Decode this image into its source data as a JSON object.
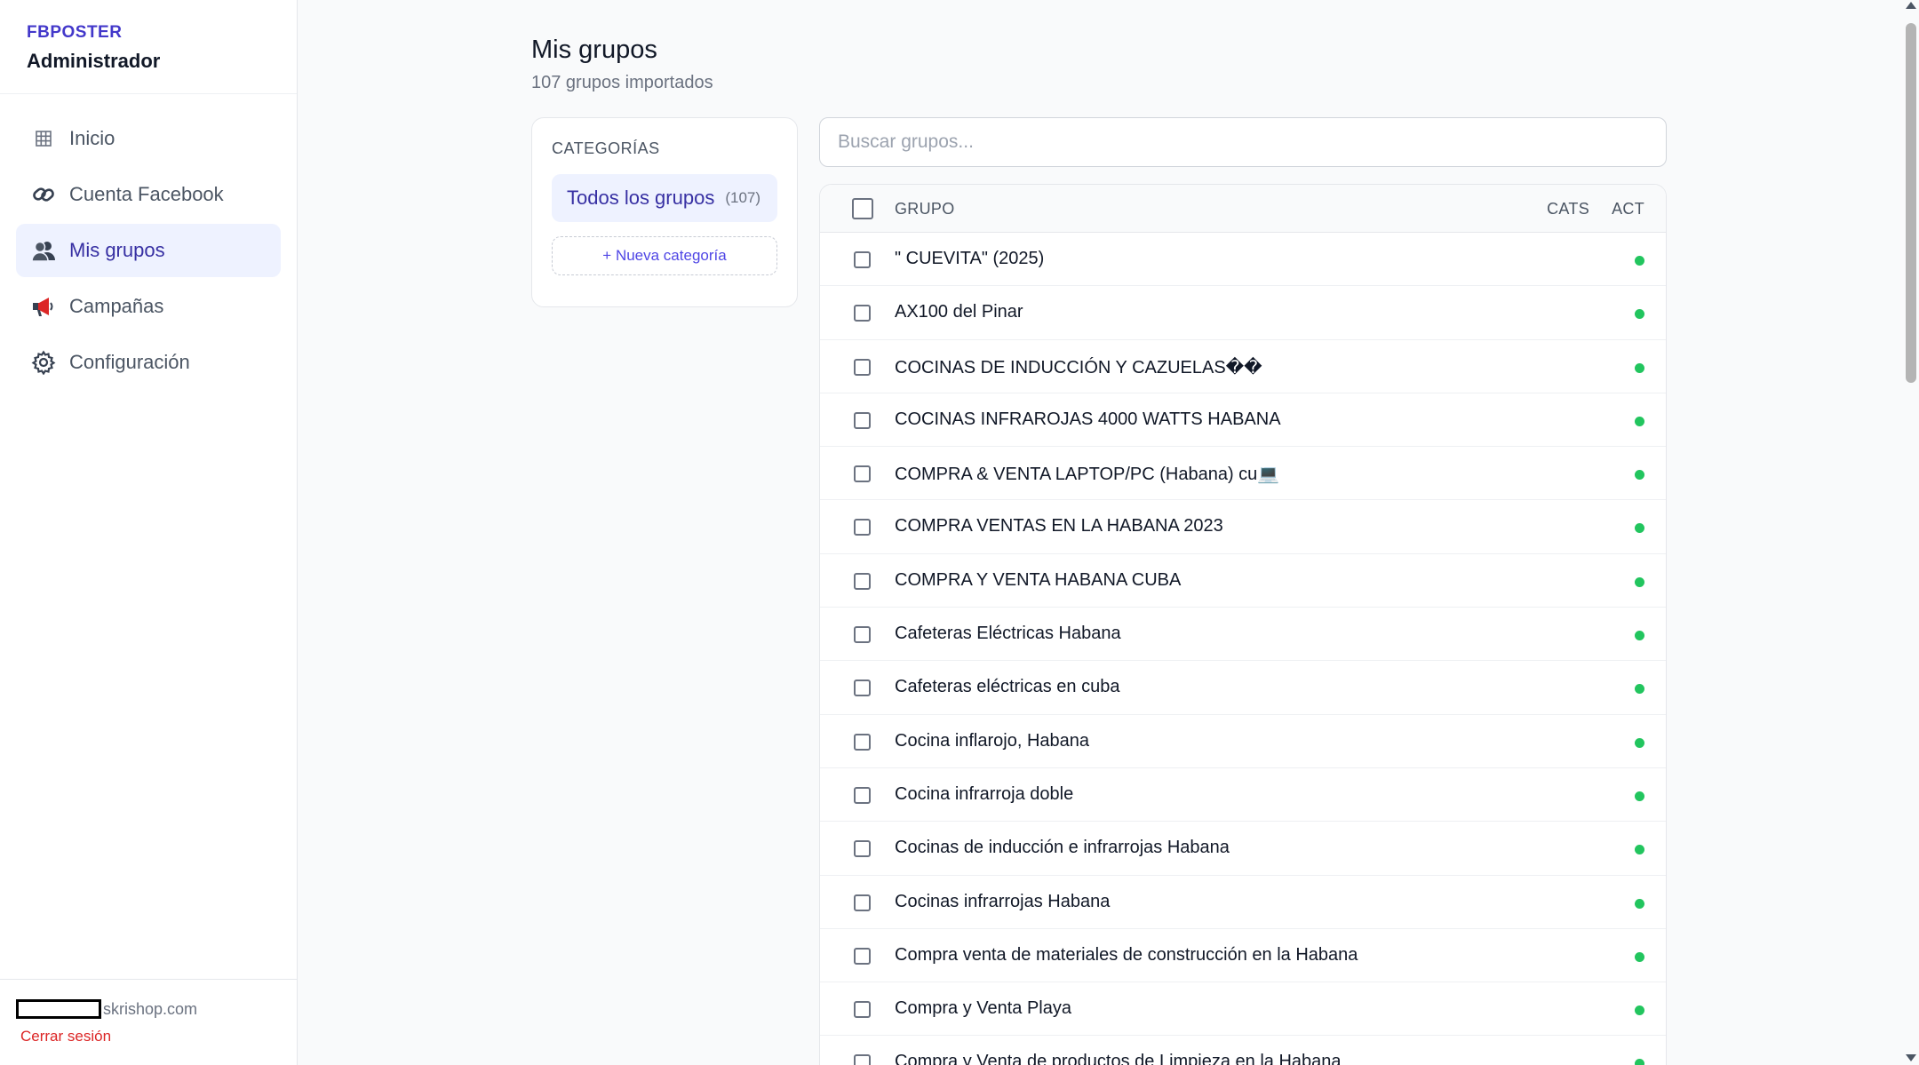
{
  "brand": {
    "name": "FBPOSTER",
    "role": "Administrador"
  },
  "nav": {
    "items": [
      {
        "label": "Inicio",
        "icon": "grid-icon"
      },
      {
        "label": "Cuenta Facebook",
        "icon": "link-icon"
      },
      {
        "label": "Mis grupos",
        "icon": "users-icon",
        "active": true
      },
      {
        "label": "Campañas",
        "icon": "megaphone-icon"
      },
      {
        "label": "Configuración",
        "icon": "gear-icon"
      }
    ]
  },
  "footer": {
    "email_suffix": "skrishop.com",
    "logout": "Cerrar sesión"
  },
  "header": {
    "title": "Mis grupos",
    "subtitle": "107 grupos importados"
  },
  "categories": {
    "title": "CATEGORÍAS",
    "all_label": "Todos los grupos",
    "all_count": "(107)",
    "new_label": "+ Nueva categoría"
  },
  "search": {
    "placeholder": "Buscar grupos..."
  },
  "table": {
    "headers": {
      "group": "GRUPO",
      "cats": "CATS",
      "act": "ACT"
    },
    "rows": [
      "\" CUEVITA\" (2025)",
      "AX100 del Pinar",
      "COCINAS DE INDUCCIÓN Y CAZUELAS��",
      "COCINAS INFRAROJAS 4000 WATTS HABANA",
      "COMPRA & VENTA LAPTOP/PC (Habana) cu💻",
      "COMPRA VENTAS EN LA HABANA 2023",
      "COMPRA Y VENTA HABANA CUBA",
      "Cafeteras Eléctricas Habana",
      "Cafeteras eléctricas en cuba",
      "Cocina inflarojo, Habana",
      "Cocina infrarroja doble",
      "Cocinas de inducción e infrarrojas Habana",
      "Cocinas infrarrojas Habana",
      "Compra venta de materiales de construcción en la Habana",
      "Compra y Venta Playa",
      "Compra y Venta de productos de Limpieza en la Habana"
    ],
    "status_color": "#22c55e"
  },
  "colors": {
    "accent": "#4338ca",
    "active_bg": "#eef2ff",
    "danger": "#dc2626"
  }
}
